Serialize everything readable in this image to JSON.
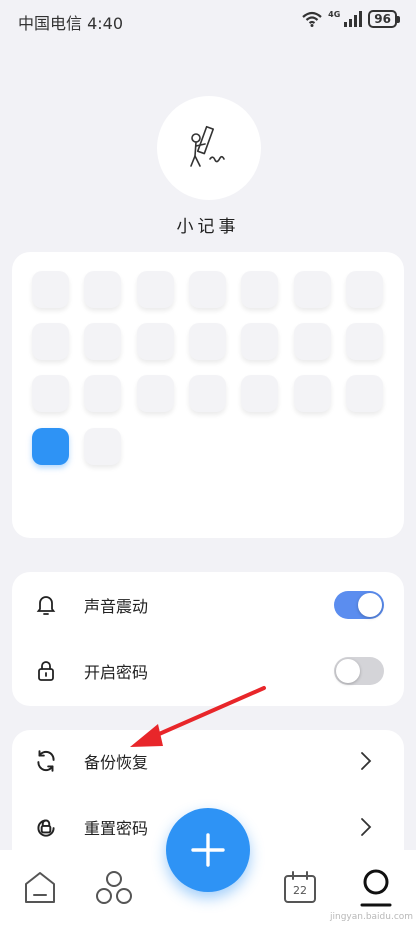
{
  "status_bar": {
    "carrier_time": "中国电信 4:40",
    "network": "4G",
    "battery": "96"
  },
  "profile": {
    "app_name": "小记事",
    "avatar_icon": "person-writing-with-pencil-icon"
  },
  "color_grid": {
    "total": 23,
    "columns": 7,
    "selected_index": 21,
    "selected_color": "#2e93f5"
  },
  "settings": [
    {
      "label": "声音震动",
      "icon": "bell-icon",
      "on": true
    },
    {
      "label": "开启密码",
      "icon": "lock-icon",
      "on": false
    }
  ],
  "data_menu": [
    {
      "label": "备份恢复",
      "icon": "sync-icon"
    },
    {
      "label": "重置密码",
      "icon": "reset-lock-icon"
    }
  ],
  "tabbar": {
    "calendar_day": "22",
    "accent": "#2e93f5"
  },
  "watermark": "jingyan.baidu.com"
}
